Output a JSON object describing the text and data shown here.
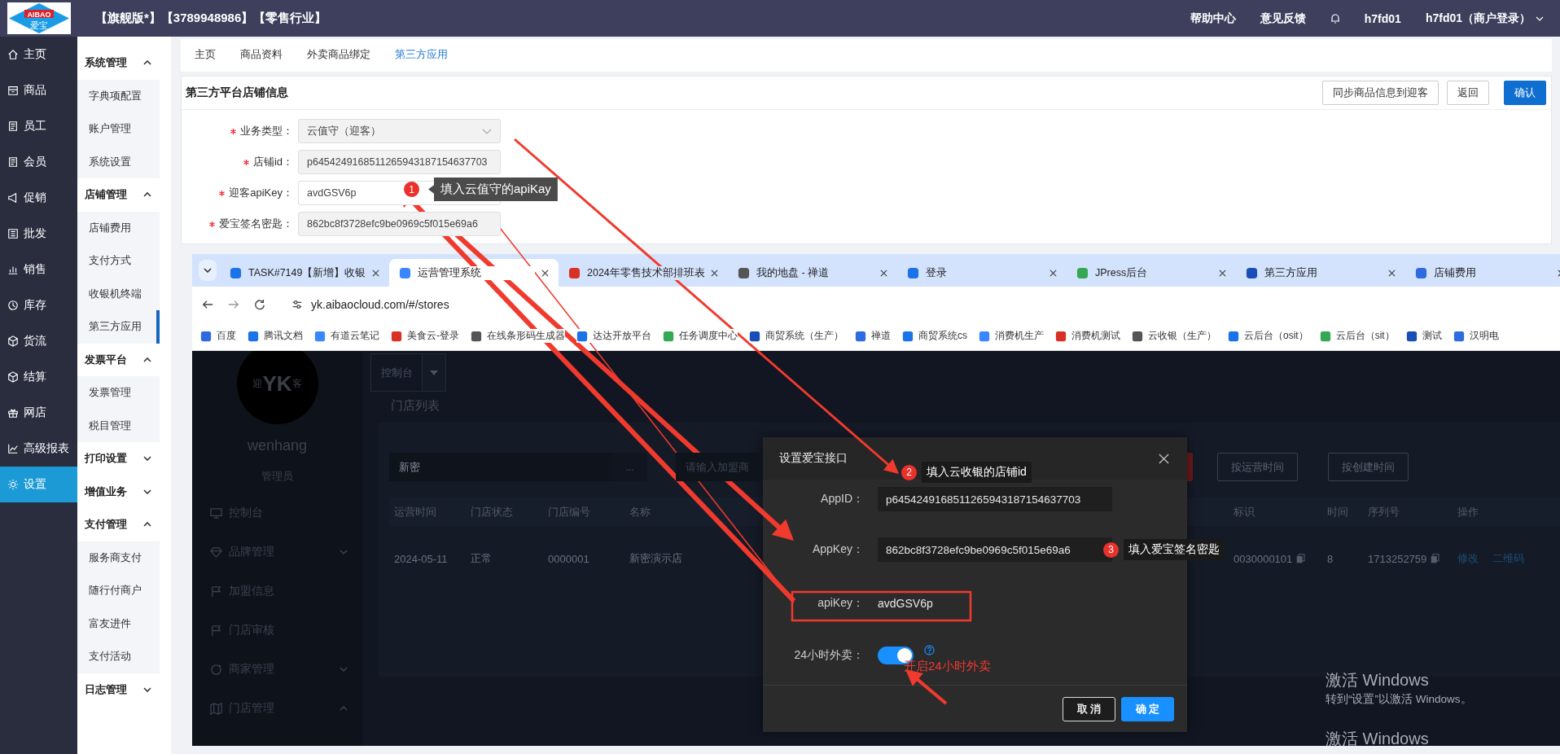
{
  "header": {
    "logo": {
      "text": "AIBAO",
      "sub": "爱宝"
    },
    "title": "【旗舰版*】【3789948986】【零售行业】",
    "links": [
      "帮助中心",
      "意见反馈"
    ],
    "user": "h7fd01",
    "account": "h7fd01（商户登录）"
  },
  "nav": [
    {
      "label": "主页",
      "selected": false
    },
    {
      "label": "商品",
      "selected": false
    },
    {
      "label": "员工",
      "selected": false
    },
    {
      "label": "会员",
      "selected": false
    },
    {
      "label": "促销",
      "selected": false
    },
    {
      "label": "批发",
      "selected": false
    },
    {
      "label": "销售",
      "selected": false
    },
    {
      "label": "库存",
      "selected": false
    },
    {
      "label": "货流",
      "selected": false
    },
    {
      "label": "结算",
      "selected": false
    },
    {
      "label": "网店",
      "selected": false
    },
    {
      "label": "高级报表",
      "selected": false
    },
    {
      "label": "设置",
      "selected": true
    }
  ],
  "subnav": [
    {
      "label": "系统管理",
      "kind": "group",
      "expanded": true
    },
    {
      "label": "字典项配置",
      "kind": "item",
      "selected": false
    },
    {
      "label": "账户管理",
      "kind": "item",
      "selected": false
    },
    {
      "label": "系统设置",
      "kind": "item",
      "selected": false
    },
    {
      "label": "店铺管理",
      "kind": "group",
      "expanded": true
    },
    {
      "label": "店铺费用",
      "kind": "item",
      "selected": false
    },
    {
      "label": "支付方式",
      "kind": "item",
      "selected": false
    },
    {
      "label": "收银机终端",
      "kind": "item",
      "selected": false
    },
    {
      "label": "第三方应用",
      "kind": "item",
      "selected": true
    },
    {
      "label": "发票平台",
      "kind": "group",
      "expanded": true
    },
    {
      "label": "发票管理",
      "kind": "item",
      "selected": false
    },
    {
      "label": "税目管理",
      "kind": "item",
      "selected": false
    },
    {
      "label": "打印设置",
      "kind": "group",
      "expanded": false
    },
    {
      "label": "增值业务",
      "kind": "group",
      "expanded": false
    },
    {
      "label": "支付管理",
      "kind": "group",
      "expanded": true
    },
    {
      "label": "服务商支付",
      "kind": "item",
      "selected": false
    },
    {
      "label": "随行付商户",
      "kind": "item",
      "selected": false
    },
    {
      "label": "富友进件",
      "kind": "item",
      "selected": false
    },
    {
      "label": "支付活动",
      "kind": "item",
      "selected": false
    },
    {
      "label": "日志管理",
      "kind": "group",
      "expanded": false
    }
  ],
  "tabs": [
    {
      "label": "主页",
      "selected": false
    },
    {
      "label": "商品资料",
      "selected": false
    },
    {
      "label": "外卖商品绑定",
      "selected": false
    },
    {
      "label": "第三方应用",
      "selected": true
    }
  ],
  "card": {
    "title": "第三方平台店铺信息",
    "buttons": [
      {
        "label": "同步商品信息到迎客",
        "kind": "default"
      },
      {
        "label": "返回",
        "kind": "default"
      },
      {
        "label": "确认",
        "kind": "primary"
      }
    ],
    "fields": [
      {
        "label": "业务类型：",
        "required": true,
        "kind": "select",
        "value": "云值守（迎客）",
        "disabled": true
      },
      {
        "label": "店铺id：",
        "required": true,
        "kind": "text",
        "value": "p6454249168511265943187154637703",
        "disabled": true
      },
      {
        "label": "迎客apiKey：",
        "required": true,
        "kind": "text",
        "value": "avdGSV6p",
        "disabled": false
      },
      {
        "label": "爱宝签名密匙：",
        "required": true,
        "kind": "text",
        "value": "862bc8f3728efc9be0969c5f015e69a6",
        "disabled": true
      }
    ]
  },
  "browser": {
    "tabs": [
      {
        "title": "TASK#7149【新增】收银",
        "selected": false
      },
      {
        "title": "运营管理系统",
        "selected": true
      },
      {
        "title": "2024年零售技术部排班表",
        "selected": false
      },
      {
        "title": "我的地盘 - 禅道",
        "selected": false
      },
      {
        "title": "登录",
        "selected": false
      },
      {
        "title": "JPress后台",
        "selected": false
      },
      {
        "title": "第三方应用",
        "selected": false
      },
      {
        "title": "店铺费用",
        "selected": false
      }
    ],
    "url": "yk.aibaocloud.com/#/stores",
    "bookmarks": [
      "百度",
      "腾讯文档",
      "有道云笔记",
      "美食云-登录",
      "在线条形码生成器",
      "达达开放平台",
      "任务调度中心",
      "商贸系统（生产）",
      "禅道",
      "商贸系统cs",
      "消费机生产",
      "消费机测试",
      "云收银（生产）",
      "云后台（osit）",
      "云后台（sit）",
      "测试",
      "汉明电"
    ],
    "app": {
      "logo": {
        "left": "迎",
        "mark": "YK",
        "right": "客"
      },
      "user": "wenhang",
      "role": "管理员",
      "menu": [
        {
          "label": "控制台",
          "kind": "link"
        },
        {
          "label": "品牌管理",
          "kind": "group",
          "expanded": false
        },
        {
          "label": "加盟信息",
          "kind": "link"
        },
        {
          "label": "门店审核",
          "kind": "link"
        },
        {
          "label": "商家管理",
          "kind": "group",
          "expanded": false
        },
        {
          "label": "门店管理",
          "kind": "group",
          "expanded": true
        }
      ],
      "tab": "控制台",
      "page_title": "门店列表",
      "search": {
        "value": "新密",
        "more": "...",
        "placeholder": "请输入加盟商"
      },
      "sort_buttons": [
        "按运营时间",
        "按创建时间"
      ],
      "table": {
        "columns": [
          "运营时间",
          "门店状态",
          "门店编号",
          "名称",
          "标识",
          "时间",
          "序列号",
          "操作"
        ],
        "rows": [
          {
            "cells": [
              "2024-05-11",
              "正常",
              "0000001",
              "新密演示店",
              "0030000101",
              "8",
              "1713252759"
            ],
            "actions": [
              "修改",
              "二维码"
            ]
          }
        ]
      },
      "dialog": {
        "title": "设置爱宝接口",
        "fields": [
          {
            "label": "AppID：",
            "kind": "input",
            "value": "p6454249168511265943187154637703"
          },
          {
            "label": "AppKey：",
            "kind": "input",
            "value": "862bc8f3728efc9be0969c5f015e69a6"
          },
          {
            "label": "apiKey：",
            "kind": "text",
            "value": "avdGSV6p"
          },
          {
            "label": "24小时外卖：",
            "kind": "switch",
            "on": true
          }
        ],
        "buttons": [
          {
            "label": "取 消",
            "kind": "default"
          },
          {
            "label": "确 定",
            "kind": "primary"
          }
        ]
      }
    }
  },
  "windows_notice": {
    "title": "激活 Windows",
    "text": "转到“设置”以激活 Windows。",
    "title_again": "激活 Windows"
  },
  "annotations": [
    {
      "number": "1",
      "text": "填入云值守的apiKay"
    },
    {
      "number": "2",
      "text": "填入云收银的店铺id"
    },
    {
      "number": "3",
      "text": "填入爱宝签名密匙"
    }
  ],
  "note": "开启24小时外卖"
}
